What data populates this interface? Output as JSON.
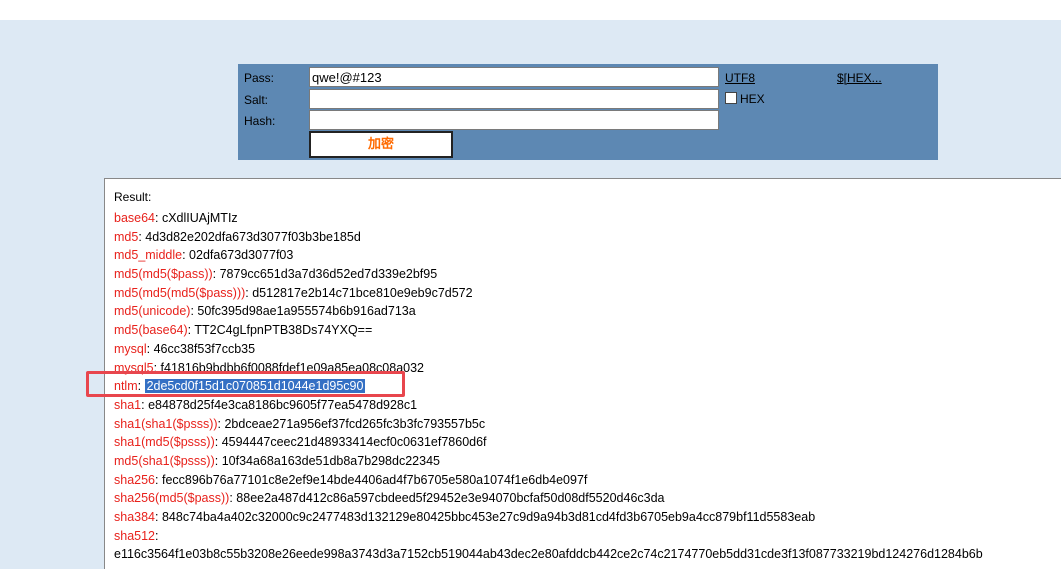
{
  "form": {
    "pass_label": "Pass:",
    "salt_label": "Salt:",
    "hash_label": "Hash:",
    "pass_value": "qwe!@#123",
    "salt_value": "",
    "hash_value": "",
    "submit_label": "加密",
    "utf8_link": "UTF8",
    "hex_link": "$[HEX...",
    "hex_checkbox_label": "HEX",
    "hex_checked": false
  },
  "result": {
    "title": "Result:",
    "rows": [
      {
        "key": "base64",
        "value": "cXdlIUAjMTIz"
      },
      {
        "key": "md5",
        "value": "4d3d82e202dfa673d3077f03b3be185d"
      },
      {
        "key": "md5_middle",
        "value": "02dfa673d3077f03"
      },
      {
        "key": "md5(md5($pass))",
        "value": "7879cc651d3a7d36d52ed7d339e2bf95"
      },
      {
        "key": "md5(md5(md5($pass)))",
        "value": "d512817e2b14c71bce810e9eb9c7d572"
      },
      {
        "key": "md5(unicode)",
        "value": "50fc395d98ae1a955574b6b916ad713a"
      },
      {
        "key": "md5(base64)",
        "value": "TT2C4gLfpnPTB38Ds74YXQ=="
      },
      {
        "key": "mysql",
        "value": "46cc38f53f7ccb35"
      },
      {
        "key": "mysql5",
        "value": "f41816b9bdbb6f0088fdef1e09a85ea08c08a032"
      },
      {
        "key": "ntlm",
        "value": "2de5cd0f15d1c070851d1044e1d95c90",
        "selected": true
      },
      {
        "key": "sha1",
        "value": "e84878d25f4e3ca8186bc9605f77ea5478d928c1"
      },
      {
        "key": "sha1(sha1($psss))",
        "value": "2bdceae271a956ef37fcd265fc3b3fc793557b5c"
      },
      {
        "key": "sha1(md5($psss))",
        "value": "4594447ceec21d48933414ecf0c0631ef7860d6f"
      },
      {
        "key": "md5(sha1($psss))",
        "value": "10f34a68a163de51db8a7b298dc22345"
      },
      {
        "key": "sha256",
        "value": "fecc896b76a77101c8e2ef9e14bde4406ad4f7b6705e580a1074f1e6db4e097f"
      },
      {
        "key": "sha256(md5($pass))",
        "value": "88ee2a487d412c86a597cbdeed5f29452e3e94070bcfaf50d08df5520d46c3da"
      },
      {
        "key": "sha384",
        "value": "848c74ba4a402c32000c9c2477483d132129e80425bbc453e27c9d9a94b3d81cd4fd3b6705eb9a4cc879bf11d5583eab"
      },
      {
        "key": "sha512",
        "value": ""
      },
      {
        "key": "",
        "value": "e116c3564f1e03b8c55b3208e26eede998a3743d3a7152cb519044ab43dec2e80afddcb442ce2c74c2174770eb5dd31cde3f13f087733219bd124276d1284b6b"
      }
    ]
  },
  "colors": {
    "page_bg": "#dde9f4",
    "panel_bg": "#5d88b3",
    "key_color": "#e8221c",
    "button_text": "#ff6a00",
    "selection_bg": "#3470c4",
    "annotation": "#e8464d"
  }
}
